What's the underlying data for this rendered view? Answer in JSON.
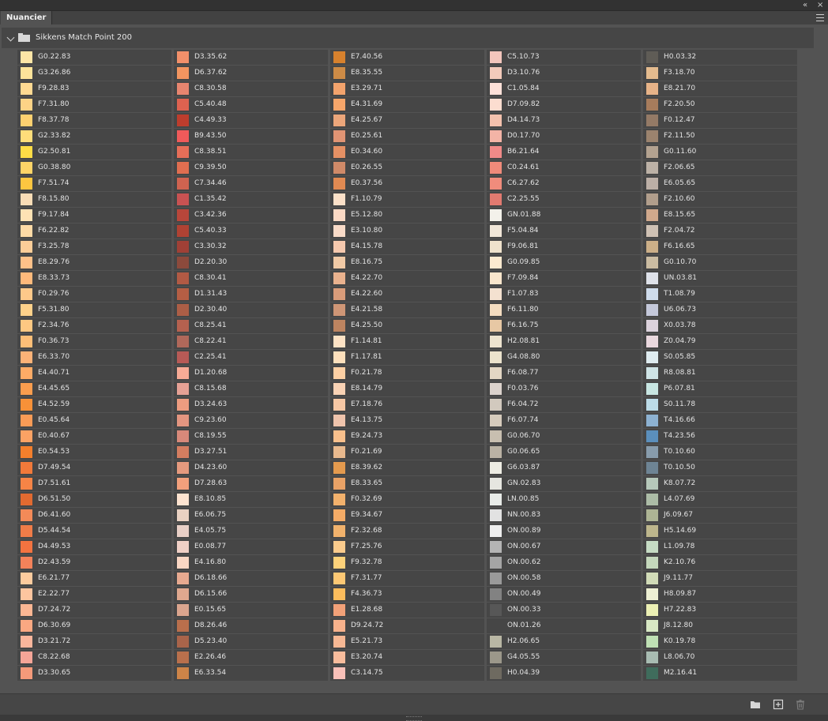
{
  "panel": {
    "tab_label": "Nuancier",
    "collapse_glyph": "«",
    "close_glyph": "×",
    "group_name": "Sikkens Match Point 200"
  },
  "icons": {
    "menu": "hamburger-menu-icon",
    "group_expand": "chevron-down-icon",
    "group_folder": "folder-icon",
    "new_group": "folder-icon",
    "new_swatch": "add-square-icon",
    "delete": "trash-icon"
  },
  "columns": [
    {
      "swatches": [
        {
          "name": "G0.22.83",
          "color": "#fde5a6"
        },
        {
          "name": "G3.26.86",
          "color": "#fde39a"
        },
        {
          "name": "F9.28.83",
          "color": "#fed992"
        },
        {
          "name": "F7.31.80",
          "color": "#fdd386"
        },
        {
          "name": "F8.37.78",
          "color": "#fdd070"
        },
        {
          "name": "G2.33.82",
          "color": "#fedd7a"
        },
        {
          "name": "G2.50.81",
          "color": "#fedc46"
        },
        {
          "name": "G0.38.80",
          "color": "#fed467"
        },
        {
          "name": "F7.51.74",
          "color": "#fdc640"
        },
        {
          "name": "F8.15.80",
          "color": "#f9dcb6"
        },
        {
          "name": "F9.17.84",
          "color": "#fee2b4"
        },
        {
          "name": "F6.22.82",
          "color": "#fddaa6"
        },
        {
          "name": "F3.25.78",
          "color": "#fccd98"
        },
        {
          "name": "E8.29.76",
          "color": "#fec189"
        },
        {
          "name": "E8.33.73",
          "color": "#feb97b"
        },
        {
          "name": "F0.29.76",
          "color": "#fec98a"
        },
        {
          "name": "F5.31.80",
          "color": "#fed18a"
        },
        {
          "name": "F2.34.76",
          "color": "#fec882"
        },
        {
          "name": "F0.36.73",
          "color": "#fdbe77"
        },
        {
          "name": "E6.33.70",
          "color": "#fcb277"
        },
        {
          "name": "E4.40.71",
          "color": "#fdab66"
        },
        {
          "name": "E4.45.65",
          "color": "#fa9d4e"
        },
        {
          "name": "E4.52.59",
          "color": "#f79138"
        },
        {
          "name": "E0.45.64",
          "color": "#f99b56"
        },
        {
          "name": "E0.40.67",
          "color": "#fba264"
        },
        {
          "name": "E0.54.53",
          "color": "#f47f2c"
        },
        {
          "name": "D7.49.54",
          "color": "#f1793a"
        },
        {
          "name": "D7.51.61",
          "color": "#f68446"
        },
        {
          "name": "D6.51.50",
          "color": "#e26a30"
        },
        {
          "name": "D6.41.60",
          "color": "#f38a58"
        },
        {
          "name": "D5.44.54",
          "color": "#f07c48"
        },
        {
          "name": "D4.49.53",
          "color": "#f37340"
        },
        {
          "name": "D2.43.59",
          "color": "#f4825a"
        },
        {
          "name": "E6.21.77",
          "color": "#fdcb9e"
        },
        {
          "name": "E2.22.77",
          "color": "#fdc59f"
        },
        {
          "name": "D7.24.72",
          "color": "#fbb693"
        },
        {
          "name": "D6.30.69",
          "color": "#faa882"
        },
        {
          "name": "D3.21.72",
          "color": "#fab69c"
        },
        {
          "name": "C8.22.68",
          "color": "#f5a597"
        },
        {
          "name": "D3.30.65",
          "color": "#f49a7a"
        }
      ]
    },
    {
      "swatches": [
        {
          "name": "D3.35.62",
          "color": "#f2906a"
        },
        {
          "name": "D6.37.62",
          "color": "#f29560"
        },
        {
          "name": "C8.30.58",
          "color": "#e7856f"
        },
        {
          "name": "C5.40.48",
          "color": "#dd6250"
        },
        {
          "name": "C4.49.33",
          "color": "#bd3d2d"
        },
        {
          "name": "B9.43.50",
          "color": "#f05a5a"
        },
        {
          "name": "C8.38.51",
          "color": "#e66e58"
        },
        {
          "name": "C9.39.50",
          "color": "#e06e50"
        },
        {
          "name": "C7.34.46",
          "color": "#cf6350"
        },
        {
          "name": "C1.35.42",
          "color": "#c85252"
        },
        {
          "name": "C3.42.36",
          "color": "#b8463a"
        },
        {
          "name": "C5.40.33",
          "color": "#b04233"
        },
        {
          "name": "C3.30.32",
          "color": "#a04036"
        },
        {
          "name": "D2.20.30",
          "color": "#8c4a3c"
        },
        {
          "name": "C8.30.41",
          "color": "#b25a44"
        },
        {
          "name": "D1.31.43",
          "color": "#b55e44"
        },
        {
          "name": "D2.30.40",
          "color": "#ac5e46"
        },
        {
          "name": "C8.25.41",
          "color": "#b5614f"
        },
        {
          "name": "C8.22.41",
          "color": "#b0685a"
        },
        {
          "name": "C2.25.41",
          "color": "#b75a56"
        },
        {
          "name": "D1.20.68",
          "color": "#f7ab96"
        },
        {
          "name": "C8.15.68",
          "color": "#e6a195"
        },
        {
          "name": "D3.24.63",
          "color": "#ed9c80"
        },
        {
          "name": "C9.23.60",
          "color": "#e39580"
        },
        {
          "name": "C8.19.55",
          "color": "#d8897a"
        },
        {
          "name": "D3.27.51",
          "color": "#d47d60"
        },
        {
          "name": "D4.23.60",
          "color": "#e69a7e"
        },
        {
          "name": "D7.28.63",
          "color": "#f2a07c"
        },
        {
          "name": "E8.10.85",
          "color": "#fde3d0"
        },
        {
          "name": "E6.06.75",
          "color": "#e9d1c2"
        },
        {
          "name": "E4.05.75",
          "color": "#e8cfc6"
        },
        {
          "name": "E0.08.77",
          "color": "#f0d0c6"
        },
        {
          "name": "E4.16.80",
          "color": "#fad7c4"
        },
        {
          "name": "D6.18.66",
          "color": "#e8aa90"
        },
        {
          "name": "D6.15.66",
          "color": "#dfa88f"
        },
        {
          "name": "E0.15.65",
          "color": "#dba58e"
        },
        {
          "name": "D8.26.46",
          "color": "#b96f4c"
        },
        {
          "name": "D5.23.40",
          "color": "#a9644a"
        },
        {
          "name": "E2.26.46",
          "color": "#b9704c"
        },
        {
          "name": "E6.33.54",
          "color": "#cd8448"
        }
      ]
    },
    {
      "swatches": [
        {
          "name": "E7.40.56",
          "color": "#d7812d"
        },
        {
          "name": "E8.35.55",
          "color": "#cd8b46"
        },
        {
          "name": "E3.29.71",
          "color": "#f3a36c"
        },
        {
          "name": "E4.31.69",
          "color": "#f7a66a"
        },
        {
          "name": "E4.25.67",
          "color": "#eca67a"
        },
        {
          "name": "E0.25.61",
          "color": "#e09474"
        },
        {
          "name": "E0.34.60",
          "color": "#e59064"
        },
        {
          "name": "E0.26.55",
          "color": "#d08a68"
        },
        {
          "name": "E0.37.56",
          "color": "#e18a52"
        },
        {
          "name": "F1.10.79",
          "color": "#fbe0c8"
        },
        {
          "name": "E5.12.80",
          "color": "#fbd9c4"
        },
        {
          "name": "E3.10.80",
          "color": "#f9dbc8"
        },
        {
          "name": "E4.15.78",
          "color": "#f6c9ae"
        },
        {
          "name": "E8.16.75",
          "color": "#f1caa6"
        },
        {
          "name": "E4.22.70",
          "color": "#eab28e"
        },
        {
          "name": "E4.22.60",
          "color": "#d99c7a"
        },
        {
          "name": "E4.21.58",
          "color": "#cf9676"
        },
        {
          "name": "E4.25.50",
          "color": "#bd8460"
        },
        {
          "name": "F1.14.81",
          "color": "#fde2c4"
        },
        {
          "name": "F1.17.81",
          "color": "#fde0bc"
        },
        {
          "name": "F0.21.78",
          "color": "#fdd0a4"
        },
        {
          "name": "E8.14.79",
          "color": "#f9d2b4"
        },
        {
          "name": "E7.18.76",
          "color": "#f6c7a4"
        },
        {
          "name": "E4.13.75",
          "color": "#efc4ac"
        },
        {
          "name": "E9.24.73",
          "color": "#f9c08c"
        },
        {
          "name": "F0.21.69",
          "color": "#e8b98e"
        },
        {
          "name": "E8.39.62",
          "color": "#e49a4e"
        },
        {
          "name": "E8.33.65",
          "color": "#e9a266"
        },
        {
          "name": "F0.32.69",
          "color": "#f2b16c"
        },
        {
          "name": "E9.34.67",
          "color": "#f4ab66"
        },
        {
          "name": "F2.32.68",
          "color": "#f1b26c"
        },
        {
          "name": "F7.25.76",
          "color": "#fbcb8c"
        },
        {
          "name": "F9.32.78",
          "color": "#fdd27a"
        },
        {
          "name": "F7.31.77",
          "color": "#fdc874"
        },
        {
          "name": "F4.36.73",
          "color": "#fbbc5c"
        },
        {
          "name": "E1.28.68",
          "color": "#f2a178"
        },
        {
          "name": "D9.24.72",
          "color": "#f8b28c"
        },
        {
          "name": "E5.21.73",
          "color": "#f7b894"
        },
        {
          "name": "E3.20.74",
          "color": "#f8bc9c"
        },
        {
          "name": "C3.14.75",
          "color": "#f8c0b8"
        }
      ]
    },
    {
      "swatches": [
        {
          "name": "C5.10.73",
          "color": "#f3c6bc"
        },
        {
          "name": "D3.10.76",
          "color": "#f3cbbb"
        },
        {
          "name": "C1.05.84",
          "color": "#fde0d8"
        },
        {
          "name": "D7.09.82",
          "color": "#fcddd0"
        },
        {
          "name": "D4.14.73",
          "color": "#f4c1ad"
        },
        {
          "name": "D0.17.70",
          "color": "#f3b4a6"
        },
        {
          "name": "B6.21.64",
          "color": "#f08a88"
        },
        {
          "name": "C0.24.61",
          "color": "#ef8a7a"
        },
        {
          "name": "C6.27.62",
          "color": "#f08c7c"
        },
        {
          "name": "C2.25.55",
          "color": "#e27a70"
        },
        {
          "name": "GN.01.88",
          "color": "#f3f1ea"
        },
        {
          "name": "F5.04.84",
          "color": "#f0e6d8"
        },
        {
          "name": "F9.06.81",
          "color": "#efe2cc"
        },
        {
          "name": "G0.09.85",
          "color": "#fcead0"
        },
        {
          "name": "F7.09.84",
          "color": "#fae6cc"
        },
        {
          "name": "F1.07.83",
          "color": "#f4e1d0"
        },
        {
          "name": "F6.11.80",
          "color": "#f3dcc0"
        },
        {
          "name": "F6.16.75",
          "color": "#e7c8a4"
        },
        {
          "name": "H2.08.81",
          "color": "#ede3cf"
        },
        {
          "name": "G4.08.80",
          "color": "#ebe2cc"
        },
        {
          "name": "F6.08.77",
          "color": "#e3d6c4"
        },
        {
          "name": "F0.03.76",
          "color": "#dbd2cc"
        },
        {
          "name": "F6.04.72",
          "color": "#d2c9be"
        },
        {
          "name": "F6.07.74",
          "color": "#d6cbbc"
        },
        {
          "name": "G0.06.70",
          "color": "#c8bfb0"
        },
        {
          "name": "G0.06.65",
          "color": "#bab2a4"
        },
        {
          "name": "G6.03.87",
          "color": "#eeede4"
        },
        {
          "name": "GN.02.83",
          "color": "#e6e6e0"
        },
        {
          "name": "LN.00.85",
          "color": "#e8ebe8"
        },
        {
          "name": "NN.00.83",
          "color": "#e2e2e2"
        },
        {
          "name": "ON.00.89",
          "color": "#ededed"
        },
        {
          "name": "ON.00.67",
          "color": "#b4b4b4"
        },
        {
          "name": "ON.00.62",
          "color": "#a5a5a5"
        },
        {
          "name": "ON.00.58",
          "color": "#9a9a9a"
        },
        {
          "name": "ON.00.49",
          "color": "#828282"
        },
        {
          "name": "ON.00.33",
          "color": "#575757"
        },
        {
          "name": "ON.01.26",
          "color": "#464646"
        },
        {
          "name": "H2.06.65",
          "color": "#b9b7a4"
        },
        {
          "name": "G4.05.55",
          "color": "#9c988a"
        },
        {
          "name": "H0.04.39",
          "color": "#6e6a60"
        }
      ]
    },
    {
      "swatches": [
        {
          "name": "H0.03.32",
          "color": "#5f5c56"
        },
        {
          "name": "F3.18.70",
          "color": "#e4bb8e"
        },
        {
          "name": "E8.21.70",
          "color": "#e7b388"
        },
        {
          "name": "F2.20.50",
          "color": "#a77c5c"
        },
        {
          "name": "F0.12.47",
          "color": "#947a66"
        },
        {
          "name": "F2.11.50",
          "color": "#9b836e"
        },
        {
          "name": "G0.11.60",
          "color": "#b3a290"
        },
        {
          "name": "F2.06.65",
          "color": "#bcb1a6"
        },
        {
          "name": "E6.05.65",
          "color": "#bcafa6"
        },
        {
          "name": "F2.10.60",
          "color": "#b19e8c"
        },
        {
          "name": "E8.15.65",
          "color": "#d0a88c"
        },
        {
          "name": "F2.04.72",
          "color": "#cfc1b4"
        },
        {
          "name": "F6.16.65",
          "color": "#ccaf88"
        },
        {
          "name": "G0.10.70",
          "color": "#cbbca2"
        },
        {
          "name": "UN.03.81",
          "color": "#dfe2ea"
        },
        {
          "name": "T1.08.79",
          "color": "#cfdcec"
        },
        {
          "name": "U6.06.73",
          "color": "#c4c8da"
        },
        {
          "name": "X0.03.78",
          "color": "#dcd2dc"
        },
        {
          "name": "Z0.04.79",
          "color": "#ead8de"
        },
        {
          "name": "S0.05.85",
          "color": "#dfecf0"
        },
        {
          "name": "R8.08.81",
          "color": "#cfe4e6"
        },
        {
          "name": "P6.07.81",
          "color": "#c8e6e2"
        },
        {
          "name": "S0.11.78",
          "color": "#bcdce8"
        },
        {
          "name": "T4.16.66",
          "color": "#8db2d2"
        },
        {
          "name": "T4.23.56",
          "color": "#5b8fbc"
        },
        {
          "name": "T0.10.60",
          "color": "#889cac"
        },
        {
          "name": "T0.10.50",
          "color": "#6e8494"
        },
        {
          "name": "K8.07.72",
          "color": "#b6c8ba"
        },
        {
          "name": "L4.07.69",
          "color": "#acbca6"
        },
        {
          "name": "J6.09.67",
          "color": "#adb494"
        },
        {
          "name": "H5.14.69",
          "color": "#bdb68c"
        },
        {
          "name": "L1.09.78",
          "color": "#c6dcc4"
        },
        {
          "name": "K2.10.76",
          "color": "#c4d8bc"
        },
        {
          "name": "J9.11.77",
          "color": "#d2dcb8"
        },
        {
          "name": "H8.09.87",
          "color": "#eef0d4"
        },
        {
          "name": "H7.22.83",
          "color": "#ecf0b4"
        },
        {
          "name": "J8.12.80",
          "color": "#d8e8c4"
        },
        {
          "name": "K0.19.78",
          "color": "#bfe0b4"
        },
        {
          "name": "L8.06.70",
          "color": "#a8bcb2"
        },
        {
          "name": "M2.16.41",
          "color": "#3f6c5c"
        }
      ]
    }
  ]
}
